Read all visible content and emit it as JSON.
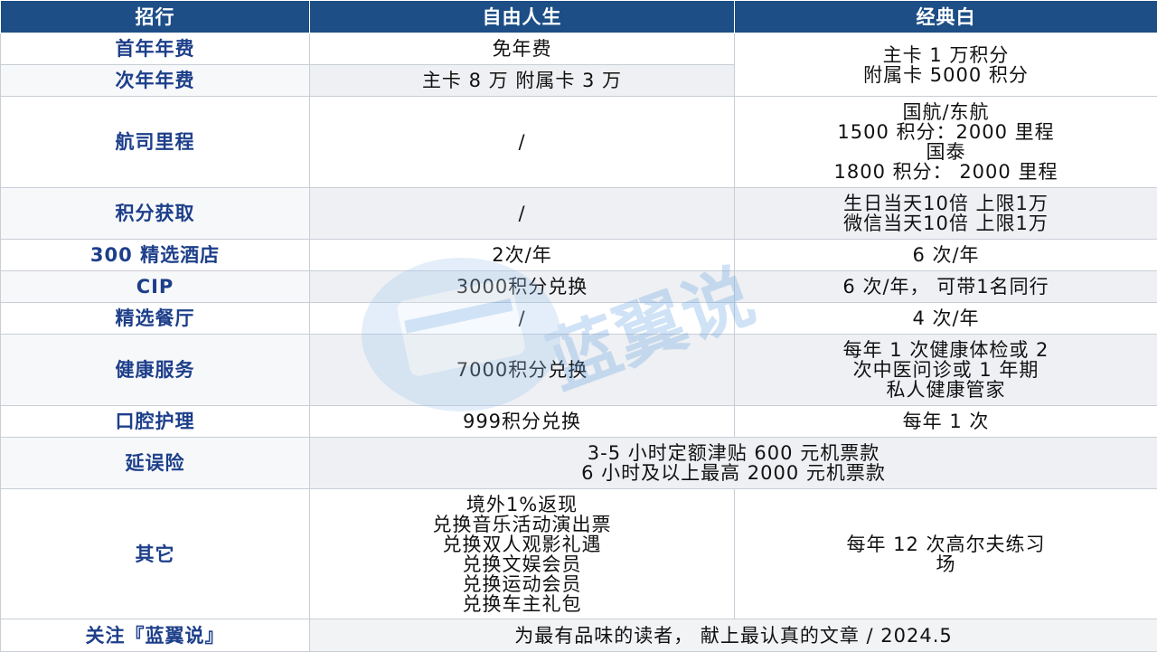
{
  "header": {
    "col1": "招行",
    "col2": "自由人生",
    "col3": "经典白"
  },
  "rows": {
    "first_year_fee": {
      "label": "首年年费",
      "col2": "免年费"
    },
    "second_year_fee": {
      "label": "次年年费",
      "col2": "主卡 8 万 附属卡 3 万"
    },
    "fee_col3": {
      "line1": "主卡 1 万积分",
      "line2": "附属卡 5000 积分"
    },
    "airline_miles": {
      "label": "航司里程",
      "col2": "/",
      "col3_lines": [
        "国航/东航",
        "1500 积分：2000 里程",
        "国泰",
        "1800 积分： 2000 里程"
      ]
    },
    "points_earning": {
      "label": "积分获取",
      "col2": "/",
      "col3_lines": [
        "生日当天10倍 上限1万",
        "微信当天10倍 上限1万"
      ]
    },
    "hotel": {
      "label": "300 精选酒店",
      "col2": "2次/年",
      "col3": "6 次/年"
    },
    "cip": {
      "label": "CIP",
      "col2": "3000积分兑换",
      "col3": "6 次/年， 可带1名同行"
    },
    "dining": {
      "label": "精选餐厅",
      "col2": "/",
      "col3": "4 次/年"
    },
    "health": {
      "label": "健康服务",
      "col2": "7000积分兑换",
      "col3_lines": [
        "每年 1 次健康体检或 2",
        "次中医问诊或 1 年期",
        "私人健康管家"
      ]
    },
    "dental": {
      "label": "口腔护理",
      "col2": "999积分兑换",
      "col3": "每年 1 次"
    },
    "delay_insurance": {
      "label": "延误险",
      "merged_lines": [
        "3-5 小时定额津贴 600 元机票款",
        "6 小时及以上最高 2000 元机票款"
      ]
    },
    "other": {
      "label": "其它",
      "col2_lines": [
        "境外1%返现",
        "兑换音乐活动演出票",
        "兑换双人观影礼遇",
        "兑换文娱会员",
        "兑换运动会员",
        "兑换车主礼包"
      ],
      "col3_lines": [
        "每年 12 次高尔夫练习",
        "场"
      ]
    }
  },
  "footer": {
    "label": "关注『蓝翼说』",
    "text": "为最有品味的读者， 献上最认真的文章 / 2024.5"
  },
  "watermark": {
    "text": "蓝翼说",
    "icon": "card-logo-icon",
    "color": "#5b9be0"
  },
  "colors": {
    "header_bg": "#1d4e86",
    "label_text": "#1d3f8a",
    "alt_row": "#eef0f3"
  }
}
